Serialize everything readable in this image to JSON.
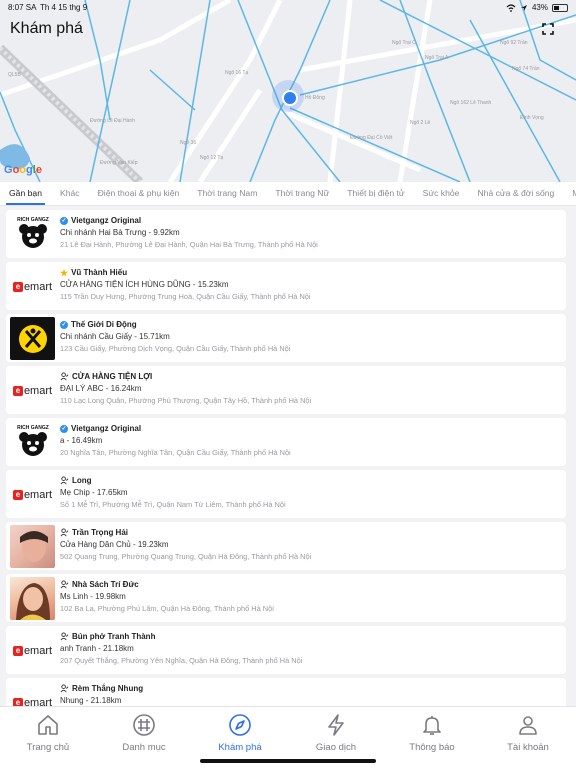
{
  "status_bar": {
    "time": "8:07 SA",
    "date": "Th 4 15 thg 9",
    "battery": "43%"
  },
  "header": {
    "title": "Khám phá"
  },
  "map": {
    "provider": "Google",
    "streets": [
      "Ngõ Trại C",
      "Ngõ Trại A",
      "Ngõ 92 Trần",
      "Ngõ 74 Trần",
      "Đường Đại Cồ Việt",
      "Ngõ 16 Tạ",
      "Ngõ 36",
      "Ngõ 162 Lê Thanh",
      "Ngõ 12 Tạ",
      "Hồ Đông",
      "Đường Vạn Kiếp",
      "QL5B",
      "Đường Lê Đại Hành",
      "Ngõ 2 Lê",
      "Đình Vọng"
    ]
  },
  "tabs": [
    "Gần bạn",
    "Khác",
    "Điện thoại & phụ kiện",
    "Thời trang Nam",
    "Thời trang Nữ",
    "Thiết bị điện tử",
    "Sức khỏe",
    "Nhà cửa & đời sống",
    "Mẹ"
  ],
  "stores": [
    {
      "name": "Vietgangz  Original",
      "badge": "verified",
      "logo": "bear-logo",
      "branch": "Chi nhánh Hai Bà Trưng - 9.92km",
      "address": "21 Lê Đại Hành, Phường Lê Đại Hành, Quận Hai Bà Trưng, Thành phố Hà Nội",
      "logo_text": "RICH GANGZ"
    },
    {
      "name": "Vũ Thành Hiếu",
      "badge": "star",
      "logo": "emart-logo",
      "branch": "CỬA HÀNG TIỆN ÍCH HÙNG DŨNG - 15.23km",
      "address": "115 Trần Duy Hưng, Phường Trung Hoà, Quận Cầu Giấy, Thành phố Hà Nội",
      "logo_text": "emart"
    },
    {
      "name": "Thế Giới Di Động",
      "badge": "verified",
      "logo": "tgdd-logo",
      "branch": "Chi nhánh Cầu Giấy - 15.71km",
      "address": "123 Cầu Giấy, Phường Dịch Vọng, Quận Cầu Giấy, Thành phố Hà Nội",
      "logo_text": ""
    },
    {
      "name": "CỬA HÀNG TIỆN LỢI",
      "badge": "user",
      "logo": "emart-logo",
      "branch": "ĐẠI LÝ ABC - 16.24km",
      "address": "110 Lạc Long Quân, Phường Phú Thượng, Quận Tây Hồ, Thành phố Hà Nội",
      "logo_text": "emart"
    },
    {
      "name": "Vietgangz  Original",
      "badge": "verified",
      "logo": "bear-logo",
      "branch": "a - 16.49km",
      "address": "20 Nghĩa Tân, Phường Nghĩa Tân, Quận Cầu Giấy, Thành phố Hà Nội",
      "logo_text": "RICH GANGZ"
    },
    {
      "name": "Long",
      "badge": "user",
      "logo": "emart-logo",
      "branch": "Mẹ Chip - 17.65km",
      "address": "Số 1 Mễ Trì, Phường Mễ Trì, Quận Nam Từ Liêm, Thành phố Hà Nội",
      "logo_text": "emart"
    },
    {
      "name": "Trần Trọng Hải",
      "badge": "user",
      "logo": "photo1",
      "branch": "Cửa Hàng Dân Chủ  - 19.23km",
      "address": "502 Quang Trung, Phường Quang Trung, Quận Hà Đông, Thành phố Hà Nội",
      "logo_text": ""
    },
    {
      "name": "Nhà Sách Trí Đức",
      "badge": "user",
      "logo": "photo2",
      "branch": "Ms Linh - 19.98km",
      "address": "102 Ba La, Phường Phú Lãm, Quận Hà Đông, Thành phố Hà Nội",
      "logo_text": ""
    },
    {
      "name": "Bún phở Tranh Thành",
      "badge": "user",
      "logo": "emart-logo",
      "branch": "anh Tranh - 21.18km",
      "address": "207 Quyết Thắng, Phường Yên Nghĩa, Quận Hà Đông, Thành phố Hà Nội",
      "logo_text": "emart"
    },
    {
      "name": "Rèm Thắng Nhung",
      "badge": "user",
      "logo": "emart-logo",
      "branch": "Nhung - 21.18km",
      "address": "",
      "logo_text": "emart"
    }
  ],
  "bottom_nav": [
    {
      "label": "Trang chủ",
      "icon": "home-icon",
      "active": false
    },
    {
      "label": "Danh mục",
      "icon": "grid-hash-icon",
      "active": false
    },
    {
      "label": "Khám phá",
      "icon": "compass-icon",
      "active": true
    },
    {
      "label": "Giao dịch",
      "icon": "lightning-icon",
      "active": false
    },
    {
      "label": "Thông báo",
      "icon": "bell-icon",
      "active": false
    },
    {
      "label": "Tài khoản",
      "icon": "person-icon",
      "active": false
    }
  ],
  "colors": {
    "accent": "#2d6ff0",
    "map_road": "#5cb7e6",
    "emart_red": "#e8231f"
  }
}
